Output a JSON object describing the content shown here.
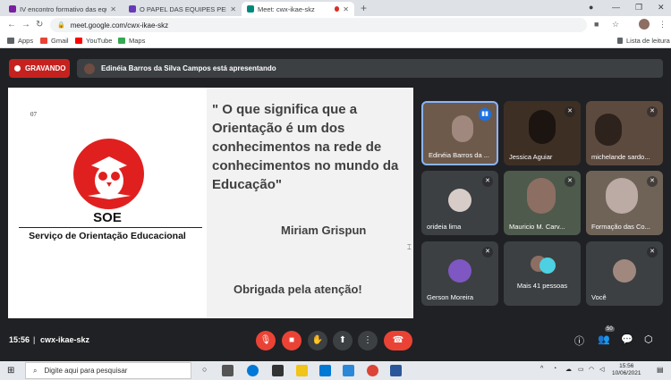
{
  "browser": {
    "tabs": [
      {
        "title": "IV encontro formativo das equipe",
        "favicon_color": "#7b1fa2",
        "active": false
      },
      {
        "title": "O PAPEL DAS EQUIPES PEDAGÓGIC",
        "favicon_color": "#673ab7",
        "active": false
      },
      {
        "title": "Meet: cwx-ikae-skz",
        "favicon_color": "#00897b",
        "active": true
      }
    ],
    "url": "meet.google.com/cwx-ikae-skz",
    "bookmarks": [
      {
        "label": "Apps",
        "color": "#5f6368"
      },
      {
        "label": "Gmail",
        "color": "#ea4335"
      },
      {
        "label": "YouTube",
        "color": "#ff0000"
      },
      {
        "label": "Maps",
        "color": "#34a853"
      }
    ],
    "reading_list": "Lista de leitura"
  },
  "meet": {
    "recording_label": "GRAVANDO",
    "presenter_text": "Edinéia Barros da Silva Campos está apresentando",
    "slide": {
      "number": "07",
      "logo_title": "SOE",
      "logo_subtitle": "Serviço de Orientação Educacional",
      "quote": "\" O que significa que a Orientação é um dos conhecimentos na rede de conhecimentos no mundo da Educação\"",
      "author": "Miriam Grispun",
      "thanks": "Obrigada pela atenção!"
    },
    "participants": [
      {
        "name": "Edinéia Barros da ...",
        "speaking": true,
        "bg": "#6d5a4b"
      },
      {
        "name": "Jessica Aguiar",
        "speaking": false,
        "bg": "#3e2f25"
      },
      {
        "name": "michelande sardo...",
        "speaking": false,
        "bg": "#5d4a3f"
      },
      {
        "name": "orideia lima",
        "speaking": false,
        "bg": "#3c4043"
      },
      {
        "name": "Mauricio M. Carv...",
        "speaking": false,
        "bg": "#4e5a4c"
      },
      {
        "name": "Formação das Co...",
        "speaking": false,
        "bg": "#6f6358"
      },
      {
        "name": "Gerson Moreira",
        "speaking": false,
        "bg": "#3c4043"
      },
      {
        "name": "Mais 41 pessoas",
        "speaking": false,
        "bg": "#3c4043"
      },
      {
        "name": "Você",
        "speaking": false,
        "bg": "#3c4043"
      }
    ],
    "time": "15:56",
    "meeting_code": "cwx-ikae-skz",
    "participant_count": "50"
  },
  "taskbar": {
    "search_placeholder": "Digite aqui para pesquisar",
    "time": "15:56",
    "date": "10/06/2021"
  }
}
